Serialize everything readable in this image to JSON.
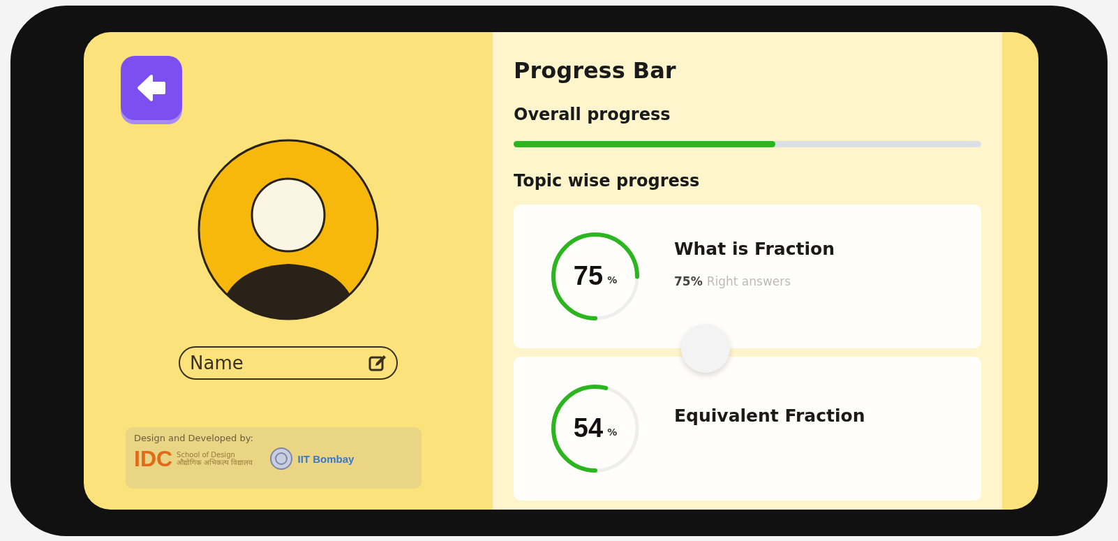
{
  "profile": {
    "name_field": {
      "placeholder": "Name"
    }
  },
  "credits": {
    "label": "Design and Developed by:",
    "idc": {
      "mark": "IDC",
      "line_1": "School of Design",
      "line_2": "औद्योगिक अभिकल्प विद्यालय"
    },
    "iit": "IIT Bombay"
  },
  "progress": {
    "title": "Progress Bar",
    "overall_label": "Overall progress",
    "overall": {
      "level": 0.56
    },
    "topic_label": "Topic wise progress",
    "topics": [
      {
        "value": "75",
        "unit": "%",
        "level": 0.75,
        "title": "What is Fraction",
        "score": "75%",
        "score_label": "Right answers"
      },
      {
        "value": "54",
        "unit": "%",
        "level": 0.54,
        "title": "Equivalent Fraction"
      }
    ]
  }
}
